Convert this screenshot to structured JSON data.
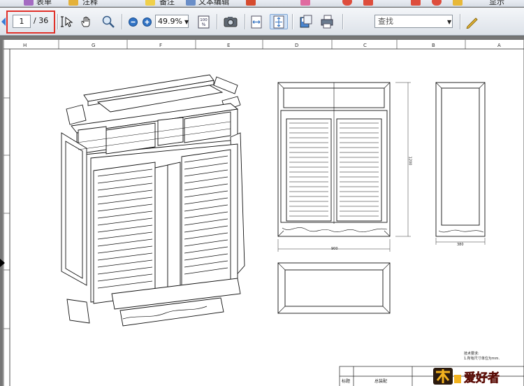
{
  "menu_bar": {
    "items": [
      {
        "label": "表单"
      },
      {
        "label": "注释"
      },
      {
        "label": "备注"
      },
      {
        "label": "文本编辑"
      },
      {
        "label": "显示"
      }
    ]
  },
  "toolbar": {
    "page_number": "1",
    "page_total": "/ 36",
    "zoom_value": "49.9%",
    "search_placeholder": "查找",
    "icons": [
      "previous-page",
      "select-tool",
      "hand-tool",
      "zoom-in-tool",
      "zoom-out",
      "zoom-in",
      "actual-size",
      "snapshot",
      "fit-width",
      "fit-page",
      "save-copy",
      "print",
      "edit-pen"
    ]
  },
  "document": {
    "column_labels": [
      "H",
      "G",
      "F",
      "E",
      "D",
      "C",
      "B",
      "A"
    ],
    "dimensions": {
      "front_height": "1200",
      "front_width": "900",
      "side_width": "380"
    },
    "tech_notes": {
      "title": "技术要求:",
      "line1": "1.所有尺寸单位为mm."
    },
    "title_block": {
      "label1": "标题",
      "label2": "总装配"
    },
    "brand_logo": "木工爱好者"
  }
}
